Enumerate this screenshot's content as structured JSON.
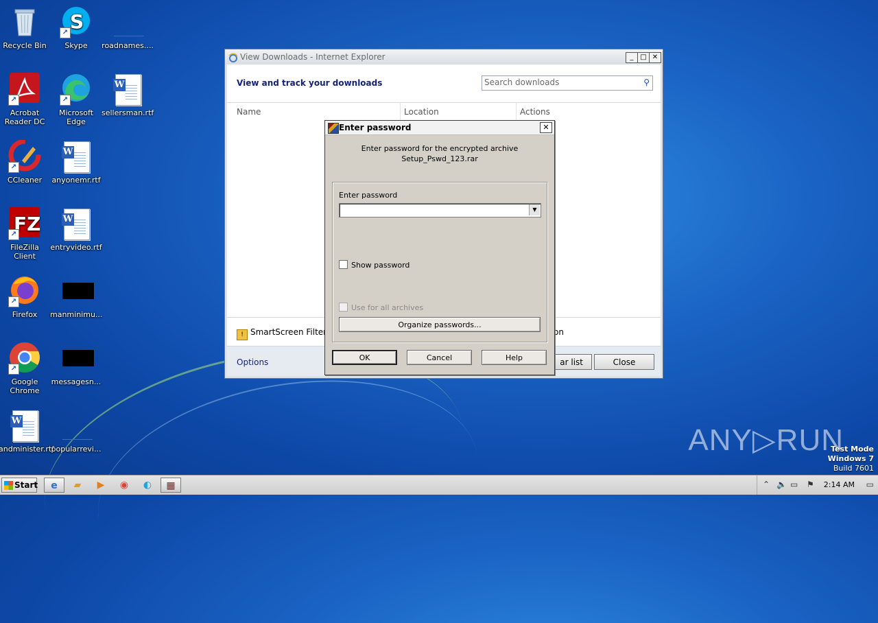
{
  "desktop": {
    "icons": [
      {
        "label": "Recycle Bin"
      },
      {
        "label": "Skype"
      },
      {
        "label": "roadnames...."
      },
      {
        "label": "Acrobat Reader DC"
      },
      {
        "label": "Microsoft Edge"
      },
      {
        "label": "sellersman.rtf"
      },
      {
        "label": "CCleaner"
      },
      {
        "label": "anyonemr.rtf"
      },
      {
        "label": "FileZilla Client"
      },
      {
        "label": "entryvideo.rtf"
      },
      {
        "label": "Firefox"
      },
      {
        "label": "manminimu..."
      },
      {
        "label": "Google Chrome"
      },
      {
        "label": "messagesn..."
      },
      {
        "label": "andminister.rtf"
      },
      {
        "label": "popularrevi..."
      }
    ]
  },
  "ie_window": {
    "title": "View Downloads - Internet Explorer",
    "heading": "View and track your downloads",
    "search_placeholder": "Search downloads",
    "columns": [
      "Name",
      "Location",
      "Actions"
    ],
    "smartscreen_text": "SmartScreen Filter is",
    "smartscreen_tail": "on",
    "options_link": "Options",
    "clear_list_button": "ar list",
    "close_button": "Close"
  },
  "password_dialog": {
    "title": "Enter password",
    "message_line1": "Enter password for the encrypted archive",
    "message_line2": "Setup_Pswd_123.rar",
    "password_label": "Enter password",
    "password_value": "",
    "show_password": "Show password",
    "use_for_all": "Use for all archives",
    "organize_button": "Organize passwords...",
    "ok_button": "OK",
    "cancel_button": "Cancel",
    "help_button": "Help"
  },
  "taskbar": {
    "start_label": "Start",
    "clock": "2:14 AM"
  },
  "overlay": {
    "watermark": "ANY▷RUN",
    "test_mode": "Test Mode",
    "os": "Windows 7",
    "build": "Build 7601"
  },
  "colors": {
    "desktop_blue": "#1a63c4",
    "link_blue": "#15227a",
    "dialog_gray": "#d4d0c8"
  }
}
